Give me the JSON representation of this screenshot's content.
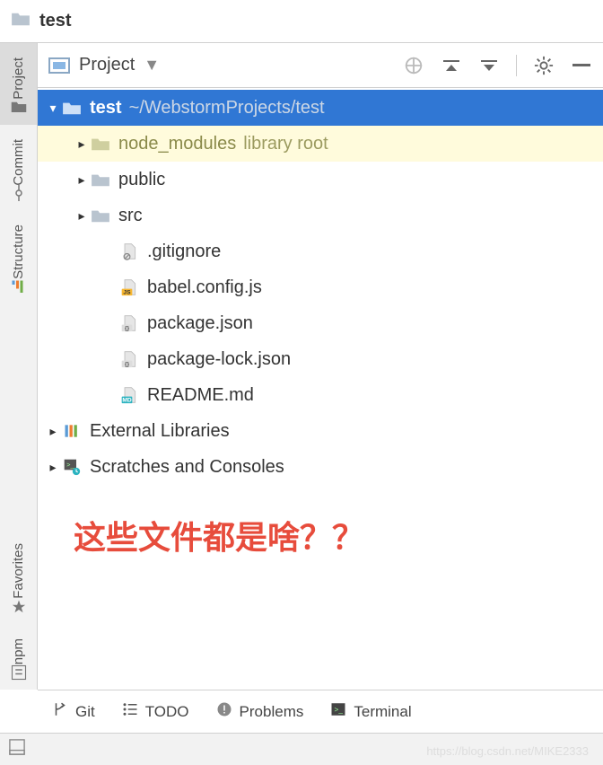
{
  "title_bar": {
    "title": "test"
  },
  "left_gutter": {
    "top": [
      {
        "id": "project",
        "label": "Project",
        "icon": "folder",
        "active": true
      },
      {
        "id": "commit",
        "label": "Commit",
        "icon": "commit",
        "active": false
      },
      {
        "id": "structure",
        "label": "Structure",
        "icon": "structure",
        "active": false
      }
    ],
    "bottom": [
      {
        "id": "favorites",
        "label": "Favorites",
        "icon": "star",
        "active": false
      },
      {
        "id": "npm",
        "label": "npm",
        "icon": "npm",
        "active": false
      }
    ]
  },
  "panel_header": {
    "title": "Project"
  },
  "tree": [
    {
      "id": "root",
      "depth": 0,
      "arrow": "down",
      "icon": "folder",
      "name": "test",
      "bold": true,
      "suffix": "~/WebstormProjects/test",
      "selected": true
    },
    {
      "id": "node_modules",
      "depth": 1,
      "arrow": "right",
      "icon": "folder-lib",
      "name": "node_modules",
      "suffix": "library root",
      "highlight": true,
      "nameColor": "#8a8a4a"
    },
    {
      "id": "public",
      "depth": 1,
      "arrow": "right",
      "icon": "folder",
      "name": "public"
    },
    {
      "id": "src",
      "depth": 1,
      "arrow": "right",
      "icon": "folder",
      "name": "src"
    },
    {
      "id": "gitignore",
      "depth": 2,
      "arrow": "none",
      "icon": "file-ignore",
      "name": ".gitignore"
    },
    {
      "id": "babel",
      "depth": 2,
      "arrow": "none",
      "icon": "file-js",
      "name": "babel.config.js"
    },
    {
      "id": "pkg",
      "depth": 2,
      "arrow": "none",
      "icon": "file-json",
      "name": "package.json"
    },
    {
      "id": "pkglock",
      "depth": 2,
      "arrow": "none",
      "icon": "file-json",
      "name": "package-lock.json"
    },
    {
      "id": "readme",
      "depth": 2,
      "arrow": "none",
      "icon": "file-md",
      "name": "README.md"
    },
    {
      "id": "ext",
      "depth": 0,
      "arrow": "right",
      "icon": "ext-lib",
      "name": "External Libraries"
    },
    {
      "id": "scratch",
      "depth": 0,
      "arrow": "right",
      "icon": "scratch",
      "name": "Scratches and Consoles"
    }
  ],
  "annotation": "这些文件都是啥？？",
  "status_bar": [
    {
      "id": "git",
      "icon": "branch",
      "label": "Git"
    },
    {
      "id": "todo",
      "icon": "list",
      "label": "TODO"
    },
    {
      "id": "problems",
      "icon": "warn",
      "label": "Problems"
    },
    {
      "id": "terminal",
      "icon": "terminal",
      "label": "Terminal"
    }
  ],
  "watermark": "https://blog.csdn.net/MIKE2333"
}
